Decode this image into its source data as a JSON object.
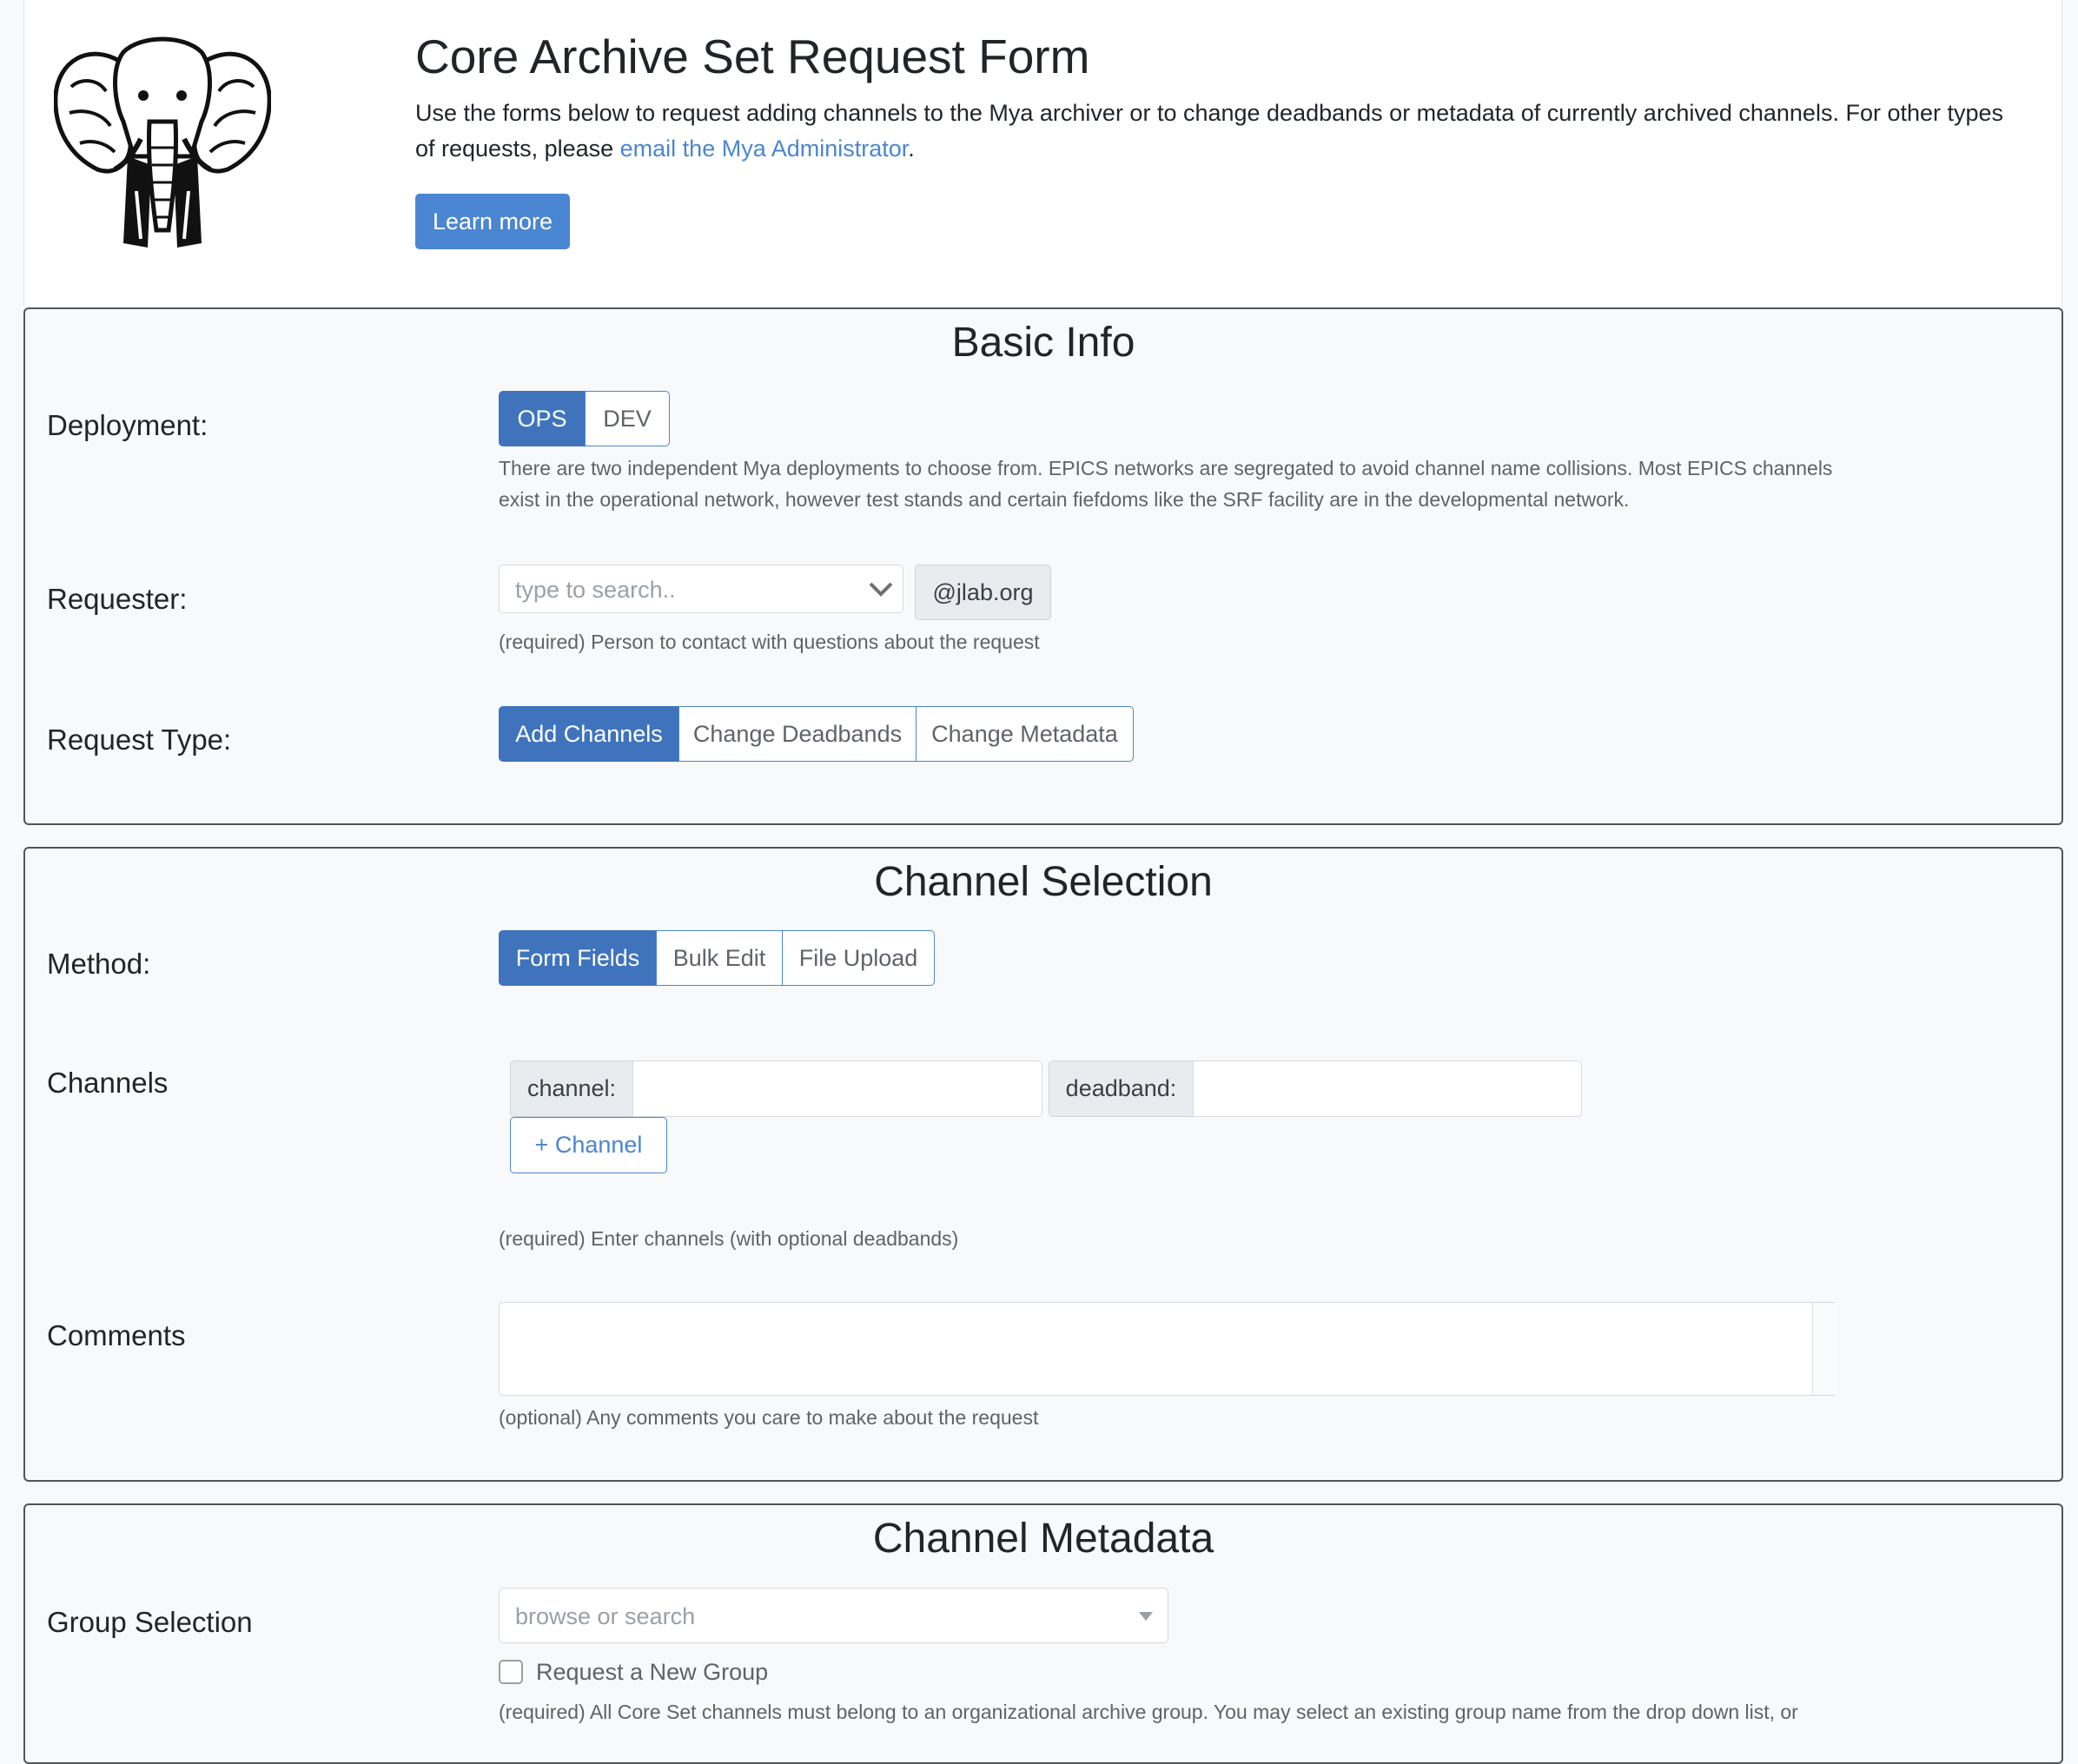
{
  "header": {
    "title": "Core Archive Set Request Form",
    "intro_text": "Use the forms below to request adding channels to the Mya archiver or to change deadbands or metadata of currently archived channels. For other types of requests, please ",
    "intro_link": "email the Mya Administrator",
    "intro_end": ".",
    "learn_more": "Learn more",
    "logo_icon": "elephant-logo"
  },
  "basic_info": {
    "title": "Basic Info",
    "deployment": {
      "label": "Deployment:",
      "options": [
        "OPS",
        "DEV"
      ],
      "selected": "OPS",
      "help": "There are two independent Mya deployments to choose from. EPICS networks are segregated to avoid channel name collisions. Most EPICS channels exist in the operational network, however test stands and certain fiefdoms like the SRF facility are in the developmental network."
    },
    "requester": {
      "label": "Requester:",
      "placeholder": "type to search..",
      "suffix": "@jlab.org",
      "help": "(required) Person to contact with questions about the request"
    },
    "request_type": {
      "label": "Request Type:",
      "options": [
        "Add Channels",
        "Change Deadbands",
        "Change Metadata"
      ],
      "selected": "Add Channels"
    }
  },
  "channel_selection": {
    "title": "Channel Selection",
    "method": {
      "label": "Method:",
      "options": [
        "Form Fields",
        "Bulk Edit",
        "File Upload"
      ],
      "selected": "Form Fields"
    },
    "channels": {
      "label": "Channels",
      "channel_addon": "channel:",
      "deadband_addon": "deadband:",
      "channel_value": "",
      "deadband_value": "",
      "add_button": "+ Channel",
      "help": "(required) Enter channels (with optional deadbands)"
    },
    "comments": {
      "label": "Comments",
      "value": "",
      "help": "(optional) Any comments you care to make about the request"
    }
  },
  "channel_metadata": {
    "title": "Channel Metadata",
    "group_selection": {
      "label": "Group Selection",
      "placeholder": "browse or search",
      "new_group_label": "Request a New Group",
      "new_group_checked": false,
      "help": "(required) All Core Set channels must belong to an organizational archive group. You may select an existing group name from the drop down list, or"
    }
  },
  "colors": {
    "primary": "#4a86d1",
    "active": "#3f74bd",
    "card_border": "#505559"
  }
}
